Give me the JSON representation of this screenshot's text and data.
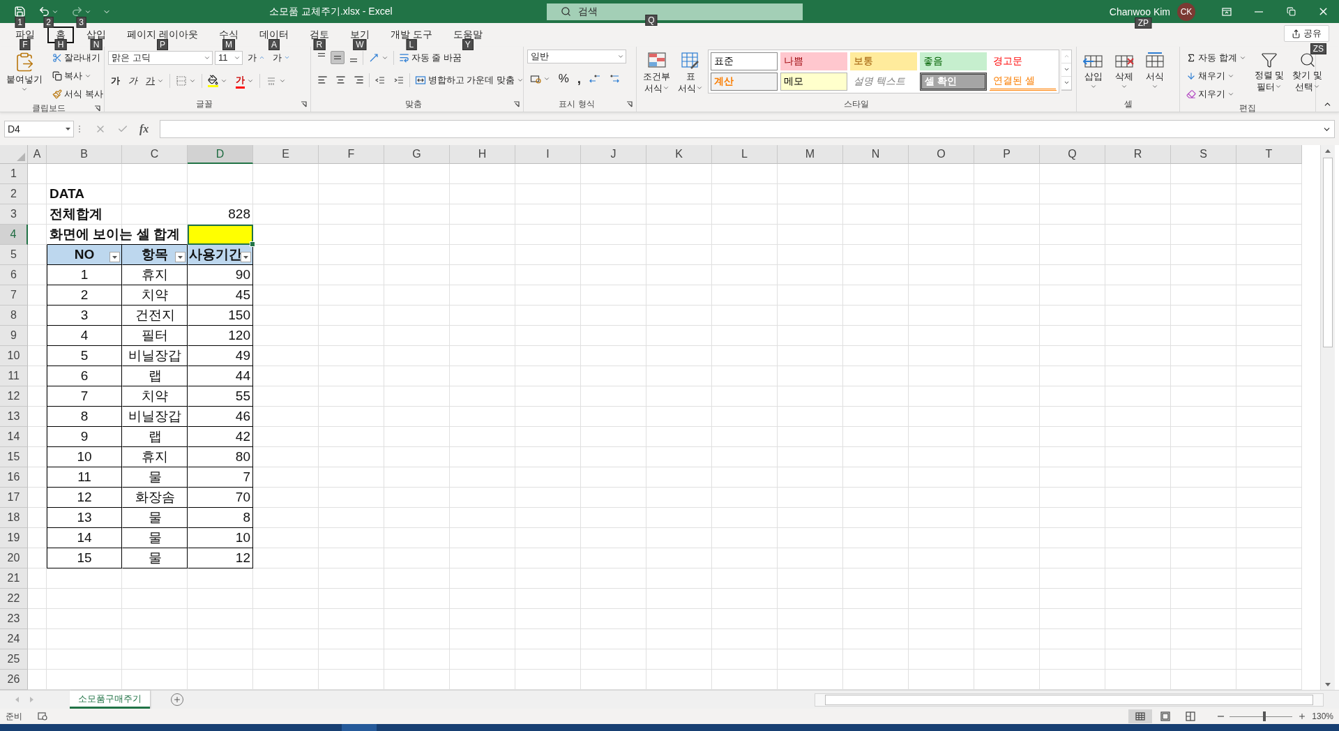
{
  "title_bar": {
    "quick_access": [
      {
        "kind": "save",
        "keytip": "1"
      },
      {
        "kind": "undo",
        "keytip": "2"
      },
      {
        "kind": "redo",
        "keytip": "3"
      }
    ],
    "title": "소모품 교체주기.xlsx - Excel",
    "search": {
      "placeholder": "검색",
      "keytip": "Q"
    },
    "user": {
      "name": "Chanwoo Kim",
      "initials": "CK",
      "keytip": "ZP"
    }
  },
  "ribbon_tabs": [
    {
      "label": "파일",
      "keytip": "F",
      "selected": false
    },
    {
      "label": "홈",
      "keytip": "H",
      "selected": true
    },
    {
      "label": "삽입",
      "keytip": "N",
      "selected": false
    },
    {
      "label": "페이지 레이아웃",
      "keytip": "P",
      "selected": false
    },
    {
      "label": "수식",
      "keytip": "M",
      "selected": false
    },
    {
      "label": "데이터",
      "keytip": "A",
      "selected": false
    },
    {
      "label": "검토",
      "keytip": "R",
      "selected": false
    },
    {
      "label": "보기",
      "keytip": "W",
      "selected": false
    },
    {
      "label": "개발 도구",
      "keytip": "L",
      "selected": false
    },
    {
      "label": "도움말",
      "keytip": "Y",
      "selected": false
    }
  ],
  "share": {
    "label": "공유",
    "keytip": "ZS"
  },
  "ribbon": {
    "clipboard": {
      "paste": "붙여넣기",
      "cut": "잘라내기",
      "copy": "복사",
      "format_painter": "서식 복사",
      "label": "클립보드"
    },
    "font": {
      "name": "맑은 고딕",
      "size": "11",
      "grow": "가",
      "shrink": "가",
      "bold": "가",
      "italic": "가",
      "underline": "가",
      "font_color": "가",
      "label": "글꼴"
    },
    "alignment": {
      "vertical": [
        {
          "kind": "top",
          "selected": false
        },
        {
          "kind": "middle",
          "selected": true
        },
        {
          "kind": "bottom",
          "selected": false
        }
      ],
      "wrap": "자동 줄 바꿈",
      "merge": "병합하고 가운데 맞춤",
      "label": "맞춤"
    },
    "number": {
      "format": "일반",
      "percent": "%",
      "comma": ",",
      "label": "표시 형식"
    },
    "styles": {
      "conditional": [
        "조건부",
        "서식"
      ],
      "table": [
        "표",
        "서식"
      ],
      "gallery": [
        {
          "kind": "normal",
          "label": "표준"
        },
        {
          "kind": "bad",
          "label": "나쁨"
        },
        {
          "kind": "neutral",
          "label": "보통"
        },
        {
          "kind": "good",
          "label": "좋음"
        },
        {
          "kind": "warning",
          "label": "경고문"
        },
        {
          "kind": "calculation",
          "label": "계산"
        },
        {
          "kind": "note",
          "label": "메모"
        },
        {
          "kind": "explanatory",
          "label": "설명 텍스트"
        },
        {
          "kind": "check",
          "label": "셀 확인"
        },
        {
          "kind": "linked",
          "label": "연결된 셀"
        }
      ],
      "label": "스타일"
    },
    "cells": {
      "buttons": [
        {
          "kind": "insert",
          "label": "삽입"
        },
        {
          "kind": "delete",
          "label": "삭제"
        },
        {
          "kind": "format",
          "label": "서식"
        }
      ],
      "label": "셀"
    },
    "editing": {
      "autosum": "자동 합계",
      "fill": "채우기",
      "clear": "지우기",
      "sort": [
        "정렬 및",
        "필터"
      ],
      "find": [
        "찾기 및",
        "선택"
      ],
      "label": "편집"
    }
  },
  "formula_bar": {
    "name_box": "D4",
    "function": "fx"
  },
  "sheet": {
    "columns": [
      {
        "label": "A",
        "selected": false
      },
      {
        "label": "B",
        "selected": false
      },
      {
        "label": "C",
        "selected": false
      },
      {
        "label": "D",
        "selected": true
      },
      {
        "label": "E",
        "selected": false
      },
      {
        "label": "F",
        "selected": false
      },
      {
        "label": "G",
        "selected": false
      },
      {
        "label": "H",
        "selected": false
      },
      {
        "label": "I",
        "selected": false
      },
      {
        "label": "J",
        "selected": false
      },
      {
        "label": "K",
        "selected": false
      },
      {
        "label": "L",
        "selected": false
      },
      {
        "label": "M",
        "selected": false
      },
      {
        "label": "N",
        "selected": false
      },
      {
        "label": "O",
        "selected": false
      },
      {
        "label": "P",
        "selected": false
      },
      {
        "label": "Q",
        "selected": false
      },
      {
        "label": "R",
        "selected": false
      },
      {
        "label": "S",
        "selected": false
      },
      {
        "label": "T",
        "selected": false
      }
    ],
    "rows": [
      {
        "label": "1",
        "selected": false
      },
      {
        "label": "2",
        "selected": false
      },
      {
        "label": "3",
        "selected": false
      },
      {
        "label": "4",
        "selected": true
      },
      {
        "label": "5",
        "selected": false
      },
      {
        "label": "6",
        "selected": false
      },
      {
        "label": "7",
        "selected": false
      },
      {
        "label": "8",
        "selected": false
      },
      {
        "label": "9",
        "selected": false
      },
      {
        "label": "10",
        "selected": false
      },
      {
        "label": "11",
        "selected": false
      },
      {
        "label": "12",
        "selected": false
      },
      {
        "label": "13",
        "selected": false
      },
      {
        "label": "14",
        "selected": false
      },
      {
        "label": "15",
        "selected": false
      },
      {
        "label": "16",
        "selected": false
      },
      {
        "label": "17",
        "selected": false
      },
      {
        "label": "18",
        "selected": false
      },
      {
        "label": "19",
        "selected": false
      },
      {
        "label": "20",
        "selected": false
      },
      {
        "label": "21",
        "selected": false
      },
      {
        "label": "22",
        "selected": false
      },
      {
        "label": "23",
        "selected": false
      },
      {
        "label": "24",
        "selected": false
      },
      {
        "label": "25",
        "selected": false
      },
      {
        "label": "26",
        "selected": false
      }
    ],
    "title": "DATA",
    "total": {
      "label": "전체합계",
      "value": "828"
    },
    "visible_total": {
      "label": "화면에 보이는 셀 합계",
      "highlighted": true,
      "selected": true
    }
  },
  "table": {
    "columns": [
      {
        "label": "NO",
        "filter": true
      },
      {
        "label": "항목",
        "filter": true
      },
      {
        "label": "사용기간",
        "filter": true
      }
    ],
    "rows": [
      [
        "1",
        "휴지",
        "90"
      ],
      [
        "2",
        "치약",
        "45"
      ],
      [
        "3",
        "건전지",
        "150"
      ],
      [
        "4",
        "필터",
        "120"
      ],
      [
        "5",
        "비닐장갑",
        "49"
      ],
      [
        "6",
        "랩",
        "44"
      ],
      [
        "7",
        "치약",
        "55"
      ],
      [
        "8",
        "비닐장갑",
        "46"
      ],
      [
        "9",
        "랩",
        "42"
      ],
      [
        "10",
        "휴지",
        "80"
      ],
      [
        "11",
        "물",
        "7"
      ],
      [
        "12",
        "화장솜",
        "70"
      ],
      [
        "13",
        "물",
        "8"
      ],
      [
        "14",
        "물",
        "10"
      ],
      [
        "15",
        "물",
        "12"
      ]
    ]
  },
  "sheet_tabs": [
    {
      "label": "소모품구매주기",
      "selected": true
    }
  ],
  "status_bar": {
    "ready": "준비",
    "views": [
      {
        "kind": "normal",
        "selected": true
      },
      {
        "kind": "page_layout",
        "selected": false
      },
      {
        "kind": "page_break",
        "selected": false
      }
    ],
    "zoom_slider": {
      "level": 0.55
    },
    "zoom": "130%"
  }
}
